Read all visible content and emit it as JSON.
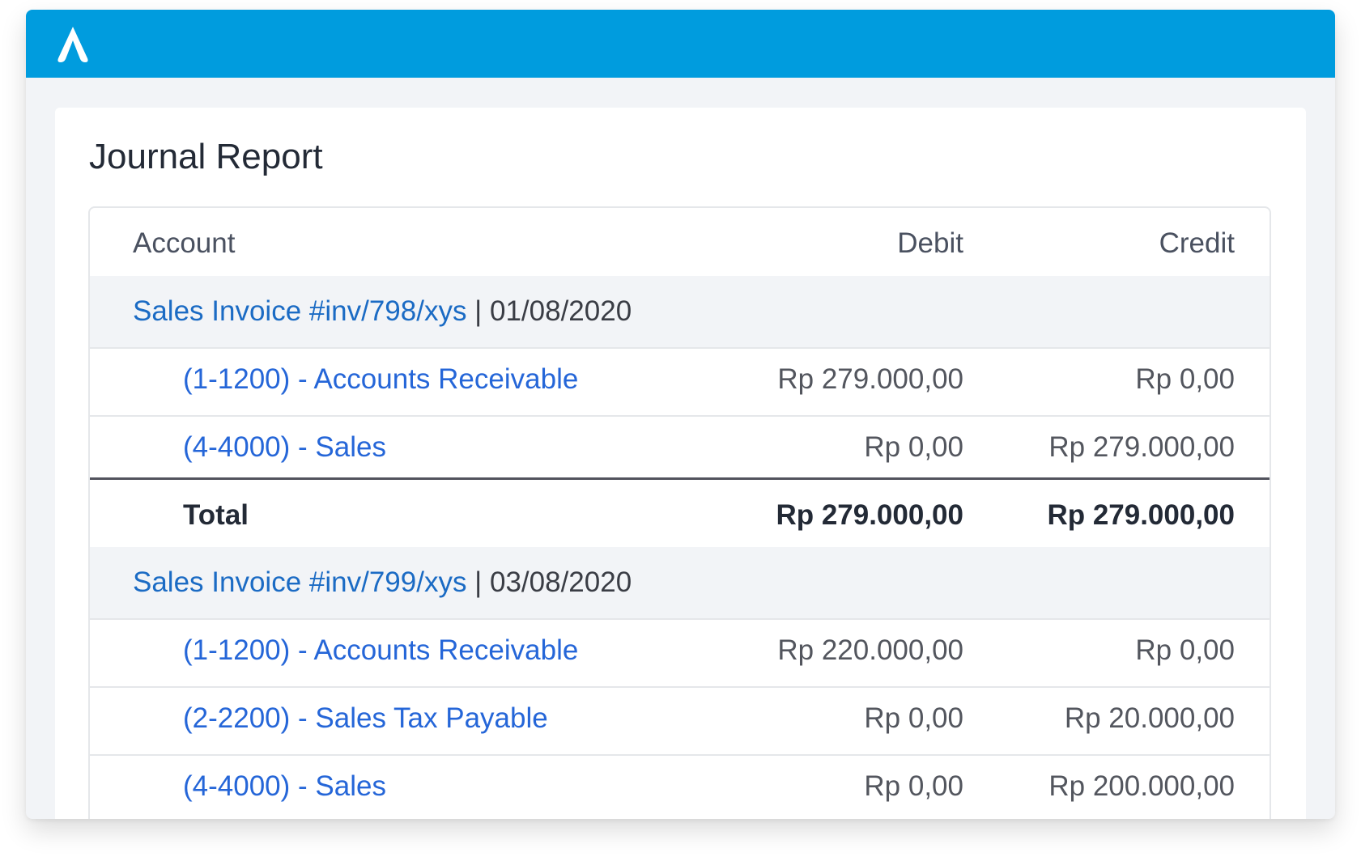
{
  "brand": {
    "color": "#009cde",
    "logo": "app-logo-icon"
  },
  "page": {
    "title": "Journal Report"
  },
  "table": {
    "columns": {
      "account": "Account",
      "debit": "Debit",
      "credit": "Credit"
    },
    "groups": [
      {
        "invoice": "Sales Invoice #inv/798/xys",
        "separator": " | ",
        "date": "01/08/2020",
        "lines": [
          {
            "account": "(1-1200) - Accounts Receivable",
            "debit": "Rp 279.000,00",
            "credit": "Rp 0,00"
          },
          {
            "account": "(4-4000) - Sales",
            "debit": "Rp 0,00",
            "credit": "Rp 279.000,00"
          }
        ],
        "total": {
          "label": "Total",
          "debit": "Rp 279.000,00",
          "credit": "Rp 279.000,00"
        }
      },
      {
        "invoice": "Sales Invoice #inv/799/xys",
        "separator": " | ",
        "date": "03/08/2020",
        "lines": [
          {
            "account": "(1-1200) - Accounts Receivable",
            "debit": "Rp 220.000,00",
            "credit": "Rp 0,00"
          },
          {
            "account": "(2-2200) - Sales Tax Payable",
            "debit": "Rp 0,00",
            "credit": "Rp 20.000,00"
          },
          {
            "account": "(4-4000) - Sales",
            "debit": "Rp 0,00",
            "credit": "Rp 200.000,00"
          }
        ]
      }
    ]
  }
}
